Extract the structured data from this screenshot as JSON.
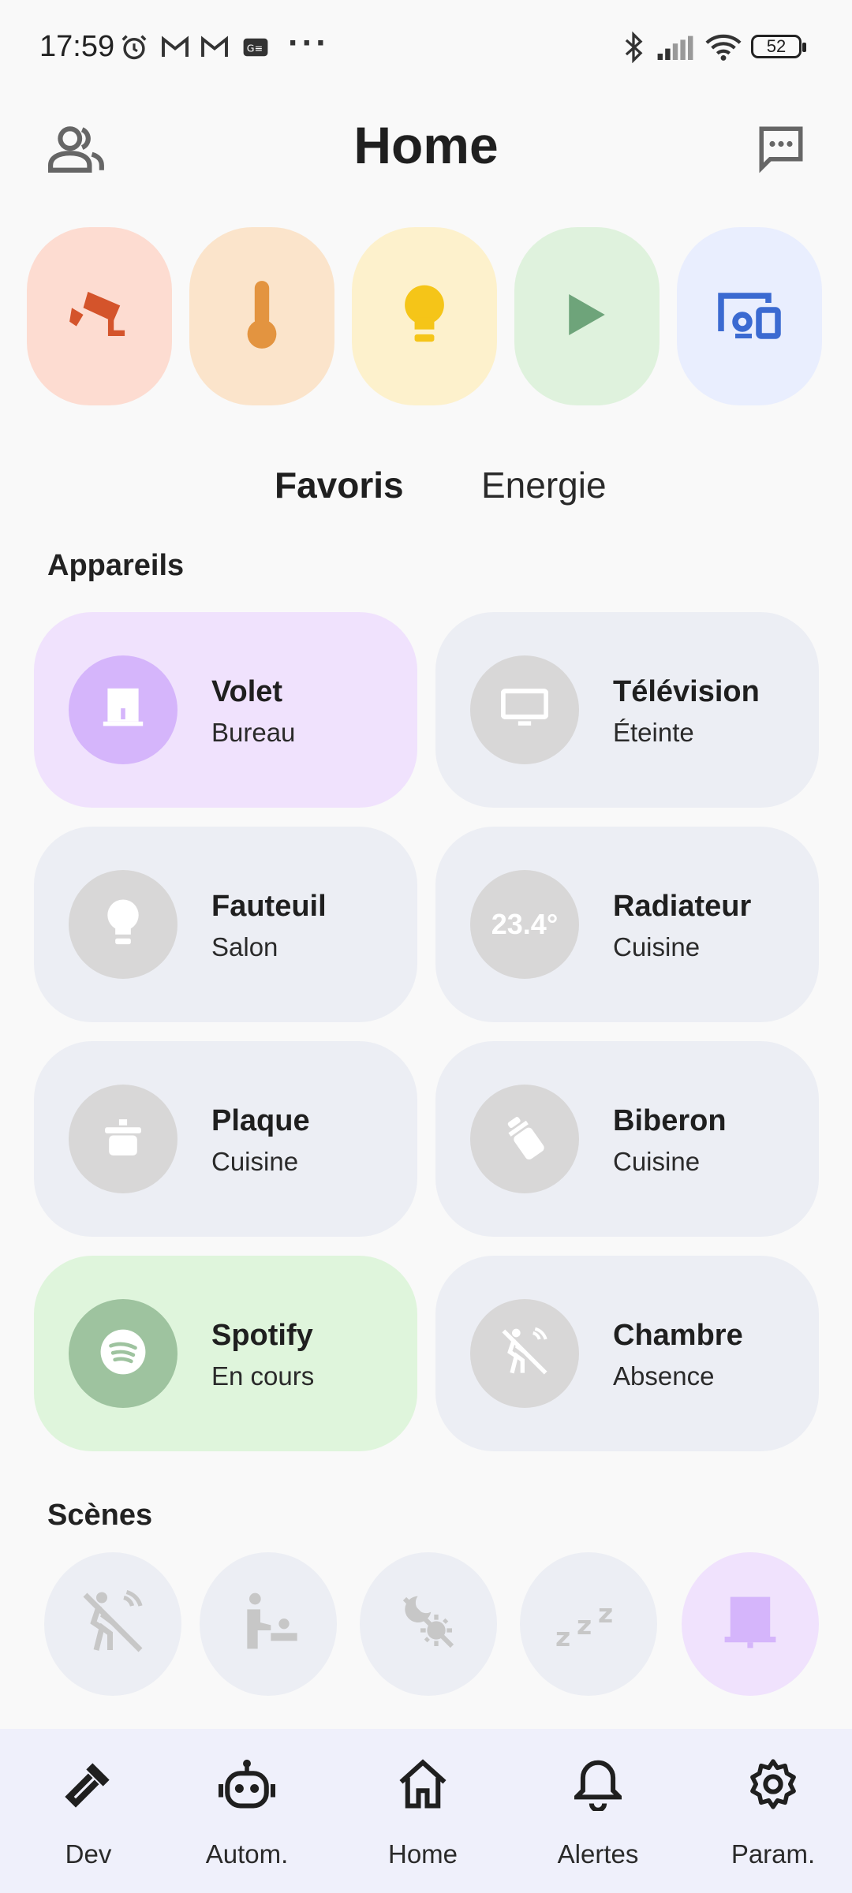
{
  "status_bar": {
    "time": "17:59",
    "more": "···",
    "battery": "52"
  },
  "header": {
    "title": "Home"
  },
  "categories": [
    {
      "icon": "security-camera-icon",
      "bg": "#fddcd1",
      "fg": "#d4542b"
    },
    {
      "icon": "thermometer-icon",
      "bg": "#fbe4cb",
      "fg": "#e39440"
    },
    {
      "icon": "lightbulb-icon",
      "bg": "#fdf1cc",
      "fg": "#f5c518"
    },
    {
      "icon": "play-icon",
      "bg": "#dff2dd",
      "fg": "#6ea47a"
    },
    {
      "icon": "devices-icon",
      "bg": "#e9eefe",
      "fg": "#3b6ad1"
    }
  ],
  "tabs": [
    "Favoris",
    "Energie"
  ],
  "sections": {
    "devices": "Appareils",
    "scenes": "Scènes"
  },
  "devices": [
    {
      "name": "Volet",
      "sub": "Bureau",
      "icon": "shutter-icon",
      "card_bg": "#f0e2fd",
      "circle_bg": "#d5b5fb"
    },
    {
      "name": "Télévision",
      "sub": "Éteinte",
      "icon": "tv-icon",
      "card_bg": "#eceef4",
      "circle_bg": "#d8d7d7"
    },
    {
      "name": "Fauteuil",
      "sub": "Salon",
      "icon": "lightbulb-icon",
      "card_bg": "#eceef4",
      "circle_bg": "#d8d7d7"
    },
    {
      "name": "Radiateur",
      "sub": "Cuisine",
      "icon": "temperature-value",
      "value": "23.4°",
      "card_bg": "#eceef4",
      "circle_bg": "#d8d7d7"
    },
    {
      "name": "Plaque",
      "sub": "Cuisine",
      "icon": "cooking-pot-icon",
      "card_bg": "#eceef4",
      "circle_bg": "#d8d7d7"
    },
    {
      "name": "Biberon",
      "sub": "Cuisine",
      "icon": "baby-bottle-icon",
      "card_bg": "#eceef4",
      "circle_bg": "#d8d7d7"
    },
    {
      "name": "Spotify",
      "sub": "En cours",
      "icon": "spotify-icon",
      "card_bg": "#dff5dc",
      "circle_bg": "#9ec39f"
    },
    {
      "name": "Chambre",
      "sub": "Absence",
      "icon": "motion-sensor-off-icon",
      "card_bg": "#eceef4",
      "circle_bg": "#d8d7d7"
    }
  ],
  "scenes": [
    {
      "icon": "motion-sensor-off-icon"
    },
    {
      "icon": "baby-changing-icon"
    },
    {
      "icon": "sun-moon-off-icon"
    },
    {
      "icon": "sleep-zzz-icon"
    },
    {
      "icon": "shutter-icon"
    }
  ],
  "bottom_nav": [
    {
      "label": "Dev",
      "icon": "hammer-icon"
    },
    {
      "label": "Autom.",
      "icon": "robot-icon"
    },
    {
      "label": "Home",
      "icon": "home-icon"
    },
    {
      "label": "Alertes",
      "icon": "bell-icon"
    },
    {
      "label": "Param.",
      "icon": "gear-icon"
    }
  ]
}
